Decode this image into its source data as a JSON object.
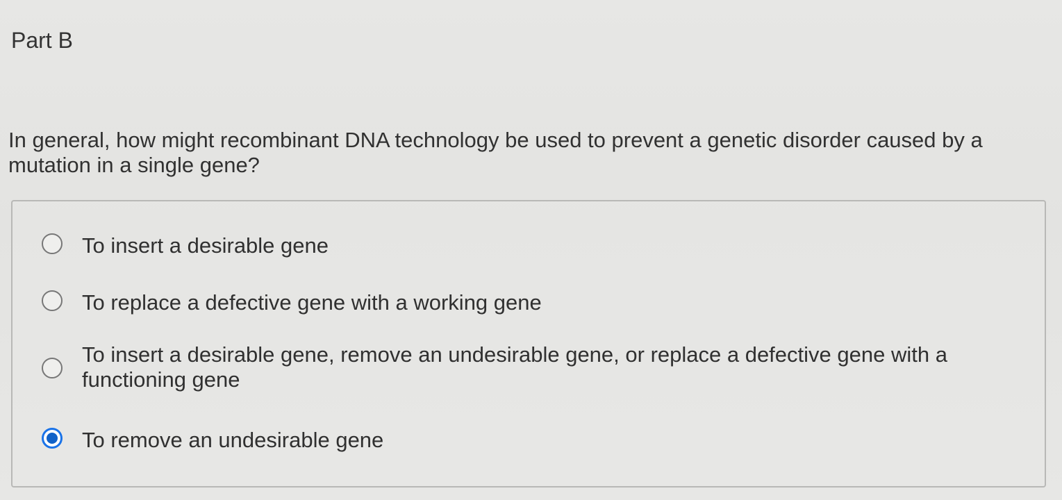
{
  "part": {
    "title": "Part B"
  },
  "question": {
    "text": "In general, how might recombinant DNA technology be used to prevent a genetic disorder caused by a mutation in a single gene?"
  },
  "answers": {
    "selected_index": 3,
    "options": [
      {
        "label": "To insert a desirable gene",
        "selected": false
      },
      {
        "label": "To replace a defective gene with a working gene",
        "selected": false
      },
      {
        "label": "To insert a desirable gene, remove an undesirable gene, or replace a defective gene with a functioning gene",
        "selected": false
      },
      {
        "label": "To remove an undesirable gene",
        "selected": true
      }
    ]
  },
  "colors": {
    "background": "#e7e7e5",
    "text": "#313131",
    "border": "#b8b8b6",
    "selected": "#1a73e8"
  }
}
